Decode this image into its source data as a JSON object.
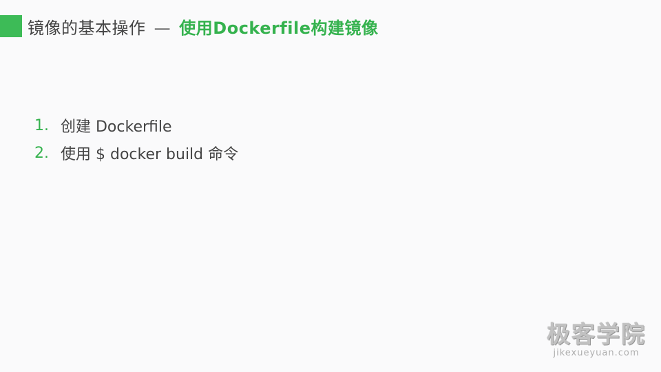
{
  "slide": {
    "title": {
      "main": "镜像的基本操作",
      "separator": "—",
      "subtitle": "使用Dockerfile构建镜像"
    },
    "steps": [
      {
        "number": "1.",
        "text": "创建 Dockerfile"
      },
      {
        "number": "2.",
        "text": "使用 $ docker build 命令"
      }
    ]
  },
  "watermark": {
    "brand": "极客学院",
    "url": "jikexueyuan.com"
  },
  "colors": {
    "accent": "#3dbb57",
    "text": "#444444",
    "background": "#fafafb"
  }
}
